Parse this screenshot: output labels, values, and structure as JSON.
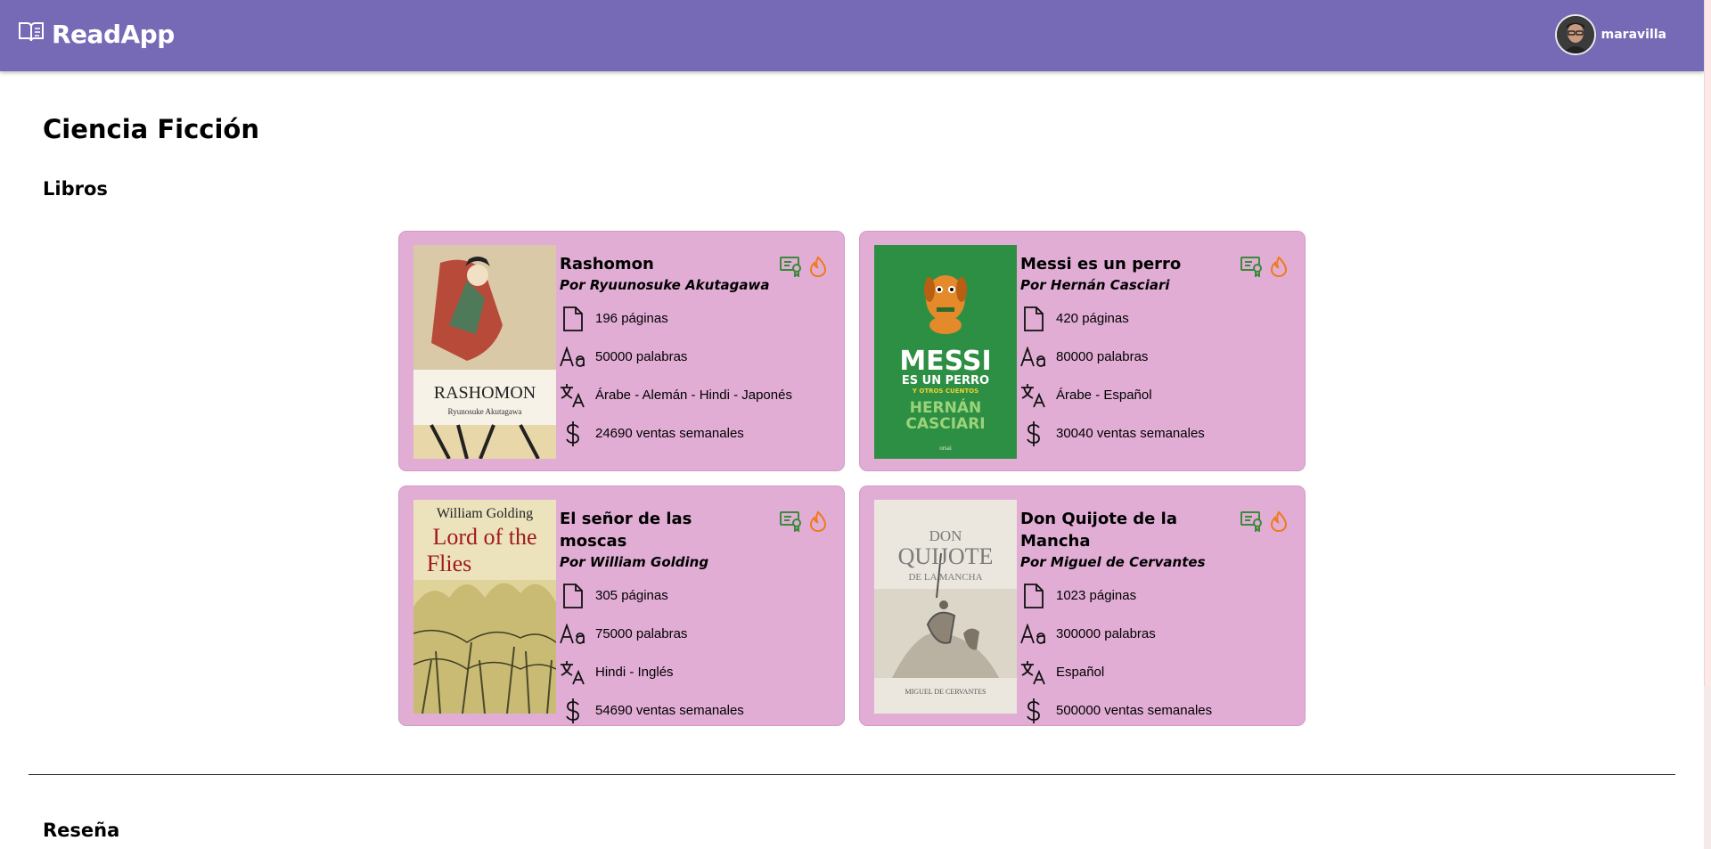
{
  "header": {
    "brand": "ReadApp",
    "username": "maravilla"
  },
  "page": {
    "title": "Ciencia Ficción",
    "books_section": "Libros",
    "review_section": "Reseña"
  },
  "colors": {
    "topbar": "#7669b6",
    "card": "#e1add5",
    "badge_green": "#3a8a3a",
    "badge_orange": "#f07a1a"
  },
  "books": [
    {
      "title": "Rashomon",
      "author": "Por Ryuunosuke Akutagawa",
      "pages": "196 páginas",
      "words": "50000 palabras",
      "languages": "Árabe - Alemán - Hindi - Japonés",
      "sales": "24690 ventas semanales",
      "cover_title": "RASHOMON",
      "cover_author": "Ryunosuke Akutagawa"
    },
    {
      "title": "Messi es un perro",
      "author": "Por Hernán Casciari",
      "pages": "420 páginas",
      "words": "80000 palabras",
      "languages": "Árabe - Español",
      "sales": "30040 ventas semanales",
      "cover_title_1": "MESSI",
      "cover_title_2": "ES UN PERRO",
      "cover_title_3": "Y OTROS CUENTOS",
      "cover_author_1": "HERNÁN",
      "cover_author_2": "CASCIARI",
      "cover_publisher": "orsai"
    },
    {
      "title": "El señor de las moscas",
      "author": "Por William Golding",
      "pages": "305 páginas",
      "words": "75000 palabras",
      "languages": "Hindi - Inglés",
      "sales": "54690 ventas semanales",
      "cover_author": "William Golding",
      "cover_title_1": "Lord of the",
      "cover_title_2": "Flies"
    },
    {
      "title": "Don Quijote de la Mancha",
      "author": "Por Miguel de Cervantes",
      "pages": "1023 páginas",
      "words": "300000 palabras",
      "languages": "Español",
      "sales": "500000 ventas semanales",
      "cover_title_1": "DON",
      "cover_title_2": "QUIJOTE",
      "cover_title_3": "DE LA MANCHA",
      "cover_author": "MIGUEL DE CERVANTES"
    }
  ],
  "icons": {
    "pages": "document-icon",
    "words": "font-size-icon",
    "languages": "translate-icon",
    "sales": "dollar-icon",
    "badge_1": "certificate-icon",
    "badge_2": "flame-icon"
  }
}
